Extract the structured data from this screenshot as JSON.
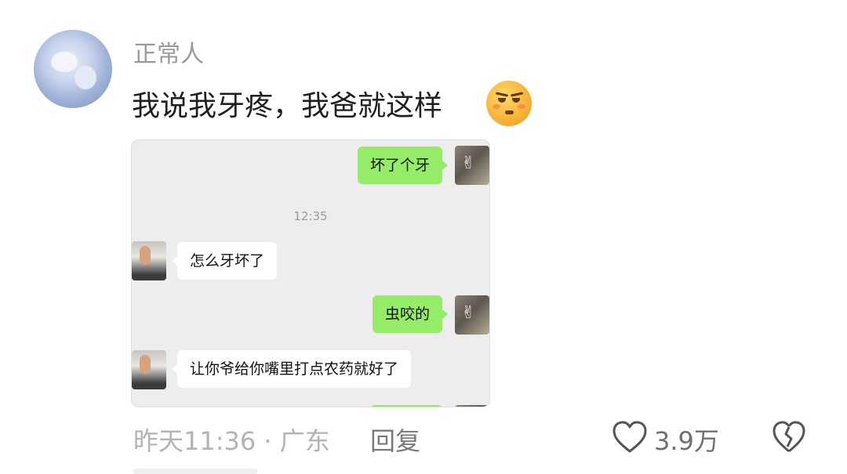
{
  "comment": {
    "username": "正常人",
    "text": "我说我牙疼，我爸就这样",
    "emoji_icon": "smirk-face-icon",
    "time_location": "昨天11:36 · 广东",
    "reply_label": "回复",
    "like_count": "3.9万",
    "like_icon": "heart-icon",
    "dislike_icon": "broken-heart-icon"
  },
  "chat_screenshot": {
    "timestamp": "12:35",
    "messages": [
      {
        "side": "right",
        "text": "坏了个牙"
      },
      {
        "side": "left",
        "text": "怎么牙坏了"
      },
      {
        "side": "right",
        "text": "虫咬的"
      },
      {
        "side": "left",
        "text": "让你爷给你嘴里打点农药就好了"
      }
    ],
    "colors": {
      "self_bubble": "#95ec69",
      "other_bubble": "#ffffff",
      "background": "#ededed"
    }
  }
}
